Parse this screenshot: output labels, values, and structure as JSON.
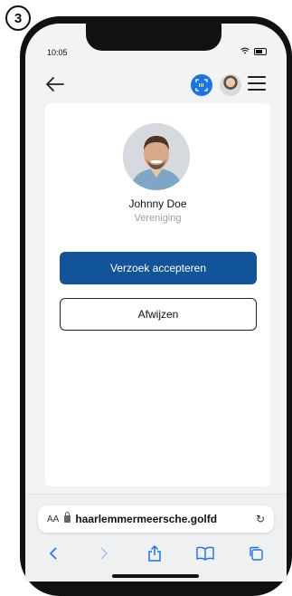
{
  "step": {
    "number": "3"
  },
  "status_bar": {
    "time": "10:05"
  },
  "profile": {
    "name": "Johnny Doe",
    "role": "Vereniging"
  },
  "actions": {
    "accept_label": "Verzoek accepteren",
    "reject_label": "Afwijzen"
  },
  "browser": {
    "text_size_label": "AA",
    "url": "haarlemmermeersche.golfd",
    "reload_glyph": "↻"
  },
  "colors": {
    "primary_button": "#11549a",
    "scan_button": "#1a73e8",
    "browser_link": "#1a73e8"
  },
  "icons": [
    "back-arrow-icon",
    "scan-icon",
    "user-avatar",
    "menu-icon",
    "lock-icon",
    "reload-icon",
    "share-icon",
    "bookmarks-icon",
    "tabs-icon"
  ]
}
